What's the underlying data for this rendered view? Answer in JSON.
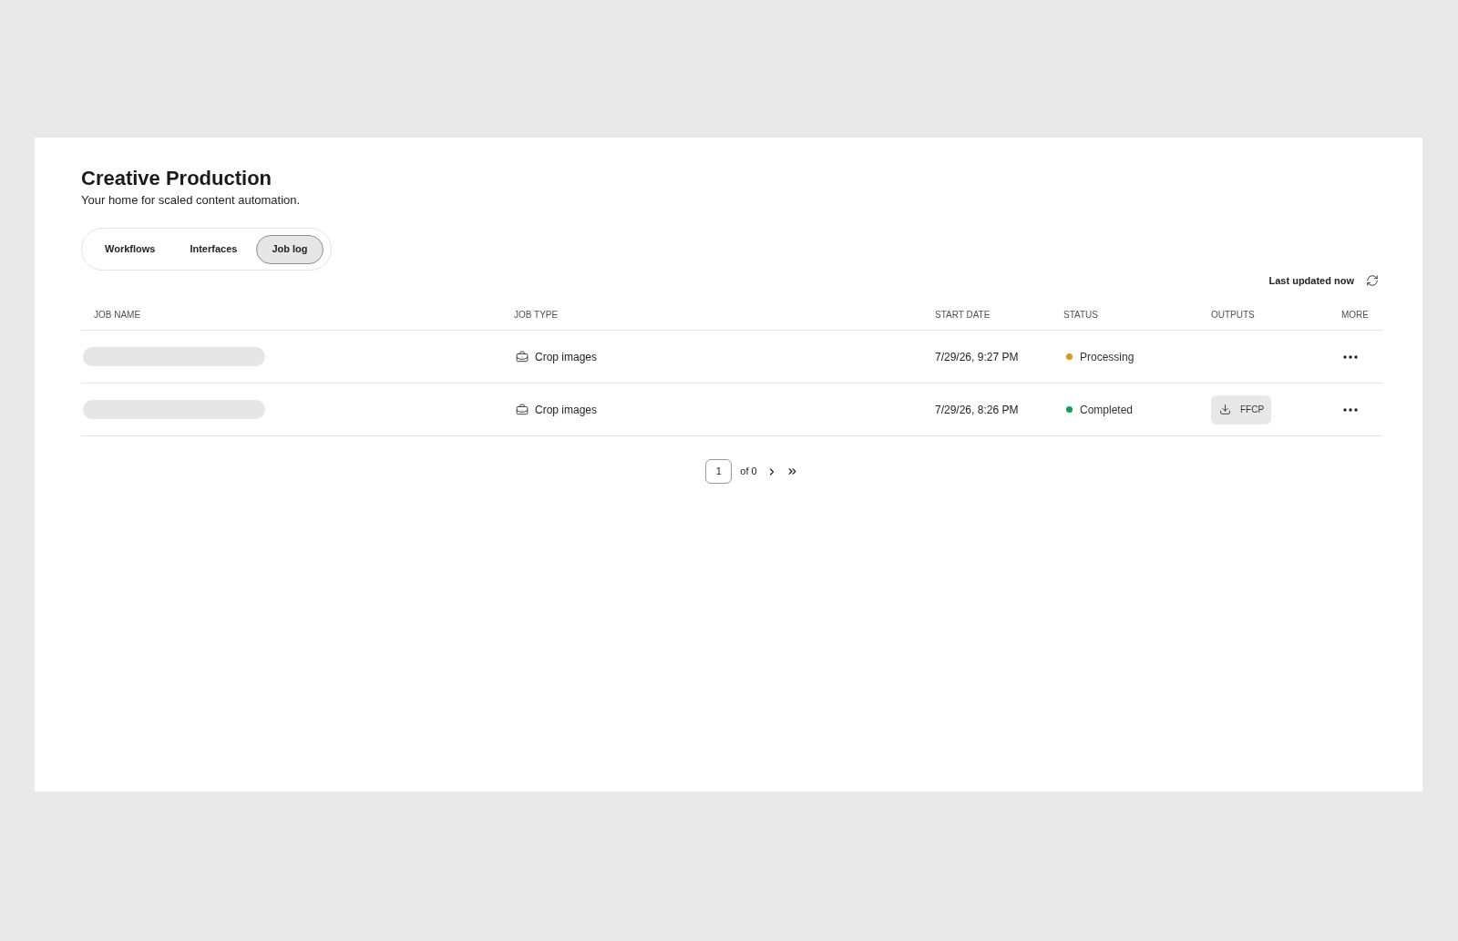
{
  "header": {
    "title": "Creative Production",
    "subtitle": "Your home for scaled content automation."
  },
  "tabs": [
    {
      "label": "Workflows",
      "selected": false
    },
    {
      "label": "Interfaces",
      "selected": false
    },
    {
      "label": "Job log",
      "selected": true
    }
  ],
  "last_updated": "Last updated now",
  "table": {
    "columns": [
      "JOB NAME",
      "JOB TYPE",
      "START DATE",
      "STATUS",
      "OUTPUTS",
      "MORE"
    ],
    "rows": [
      {
        "name_loading": true,
        "job_type": "Crop images",
        "start_date": "7/29/26, 9:27 PM",
        "status": {
          "label": "Processing",
          "color": "#e0960e"
        }
      },
      {
        "name_loading": true,
        "job_type": "Crop images",
        "start_date": "7/29/26, 8:26 PM",
        "status": {
          "label": "Completed",
          "color": "#12a150"
        },
        "outputs": [
          {
            "label": "FFCP"
          }
        ]
      }
    ]
  },
  "pagination": {
    "page": "1",
    "total": "of 0"
  }
}
